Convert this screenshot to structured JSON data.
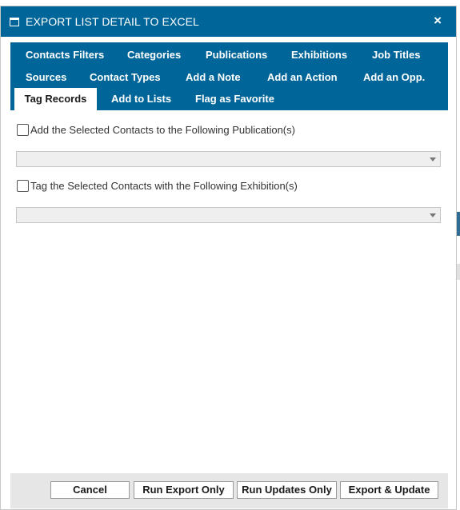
{
  "dialog": {
    "title": "EXPORT LIST DETAIL TO EXCEL",
    "close_symbol": "×",
    "icon": "window-icon",
    "accent_color": "#006699"
  },
  "tabs": {
    "row1": [
      "Contacts Filters",
      "Categories",
      "Publications",
      "Exhibitions",
      "Job Titles"
    ],
    "row2": [
      "Sources",
      "Contact Types",
      "Add a Note",
      "Add an Action",
      "Add an Opp."
    ],
    "row3": [
      "Tag Records",
      "Add to Lists",
      "Flag as Favorite"
    ],
    "active": "Tag Records"
  },
  "tag_records": {
    "publication_label": "Add the Selected Contacts to the Following Publication(s)",
    "publication_checked": false,
    "publication_value": "",
    "exhibition_label": "Tag the Selected Contacts with the Following Exhibition(s)",
    "exhibition_checked": false,
    "exhibition_value": ""
  },
  "footer": {
    "cancel_label": "Cancel",
    "run_export_label": "Run Export Only",
    "run_updates_label": "Run Updates Only",
    "export_update_label": "Export & Update"
  }
}
